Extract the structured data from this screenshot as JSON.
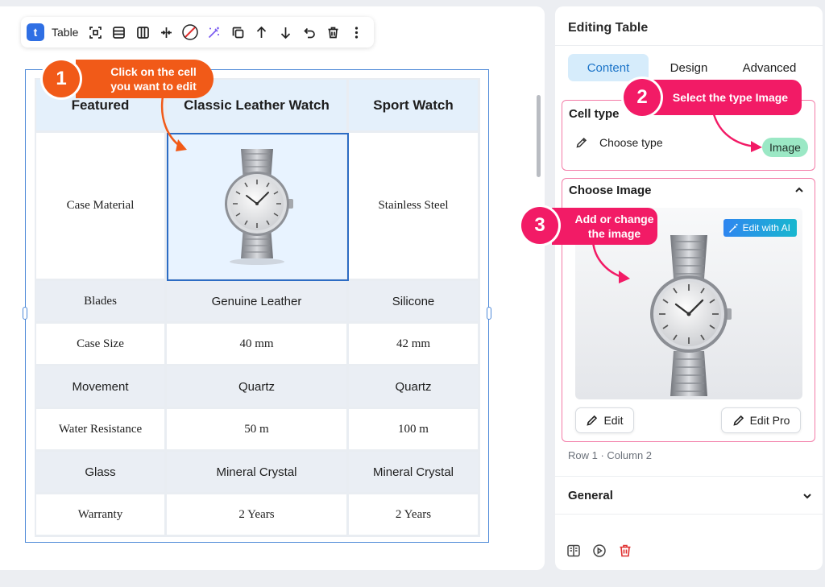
{
  "toolbar": {
    "logo": "t",
    "name": "Table",
    "icons": [
      "select-cells-icon",
      "rows-icon",
      "columns-icon",
      "split-icon",
      "no-fill-icon",
      "magic-wand-icon",
      "copy-icon",
      "arrow-up-icon",
      "arrow-down-icon",
      "undo-icon",
      "trash-icon",
      "more-icon"
    ]
  },
  "table": {
    "headers": [
      "Featured",
      "Classic Leather Watch",
      "Sport Watch"
    ],
    "image_row": {
      "label": "Case Material",
      "col3": "Stainless Steel"
    },
    "rows": [
      [
        "Blades",
        "Genuine Leather",
        "Silicone"
      ],
      [
        "Case Size",
        "40 mm",
        "42 mm"
      ],
      [
        "Movement",
        "Quartz",
        "Quartz"
      ],
      [
        "Water Resistance",
        "50 m",
        "100 m"
      ],
      [
        "Glass",
        "Mineral Crystal",
        "Mineral Crystal"
      ],
      [
        "Warranty",
        "2 Years",
        "2 Years"
      ]
    ]
  },
  "callouts": {
    "one": {
      "number": "1",
      "line1": "Click on the cell",
      "line2": "you want to edit"
    },
    "two": {
      "number": "2",
      "text": "Select the type Image"
    },
    "three": {
      "number": "3",
      "line1": "Add or change",
      "line2": "the image"
    }
  },
  "panel": {
    "title": "Editing Table",
    "tabs": [
      "Content",
      "Design",
      "Advanced"
    ],
    "cell_type": {
      "heading": "Cell type",
      "choose_label": "Choose type",
      "chip": "Image"
    },
    "choose_image": {
      "heading": "Choose Image",
      "ai_label": "Edit with AI",
      "edit_label": "Edit",
      "edit_pro_label": "Edit Pro"
    },
    "position": "Row 1 · Column 2",
    "general": "General"
  },
  "colors": {
    "accent": "#1a73c8",
    "orange": "#f15a18",
    "pink": "#f21b66",
    "selected": "#2c6cc4"
  }
}
